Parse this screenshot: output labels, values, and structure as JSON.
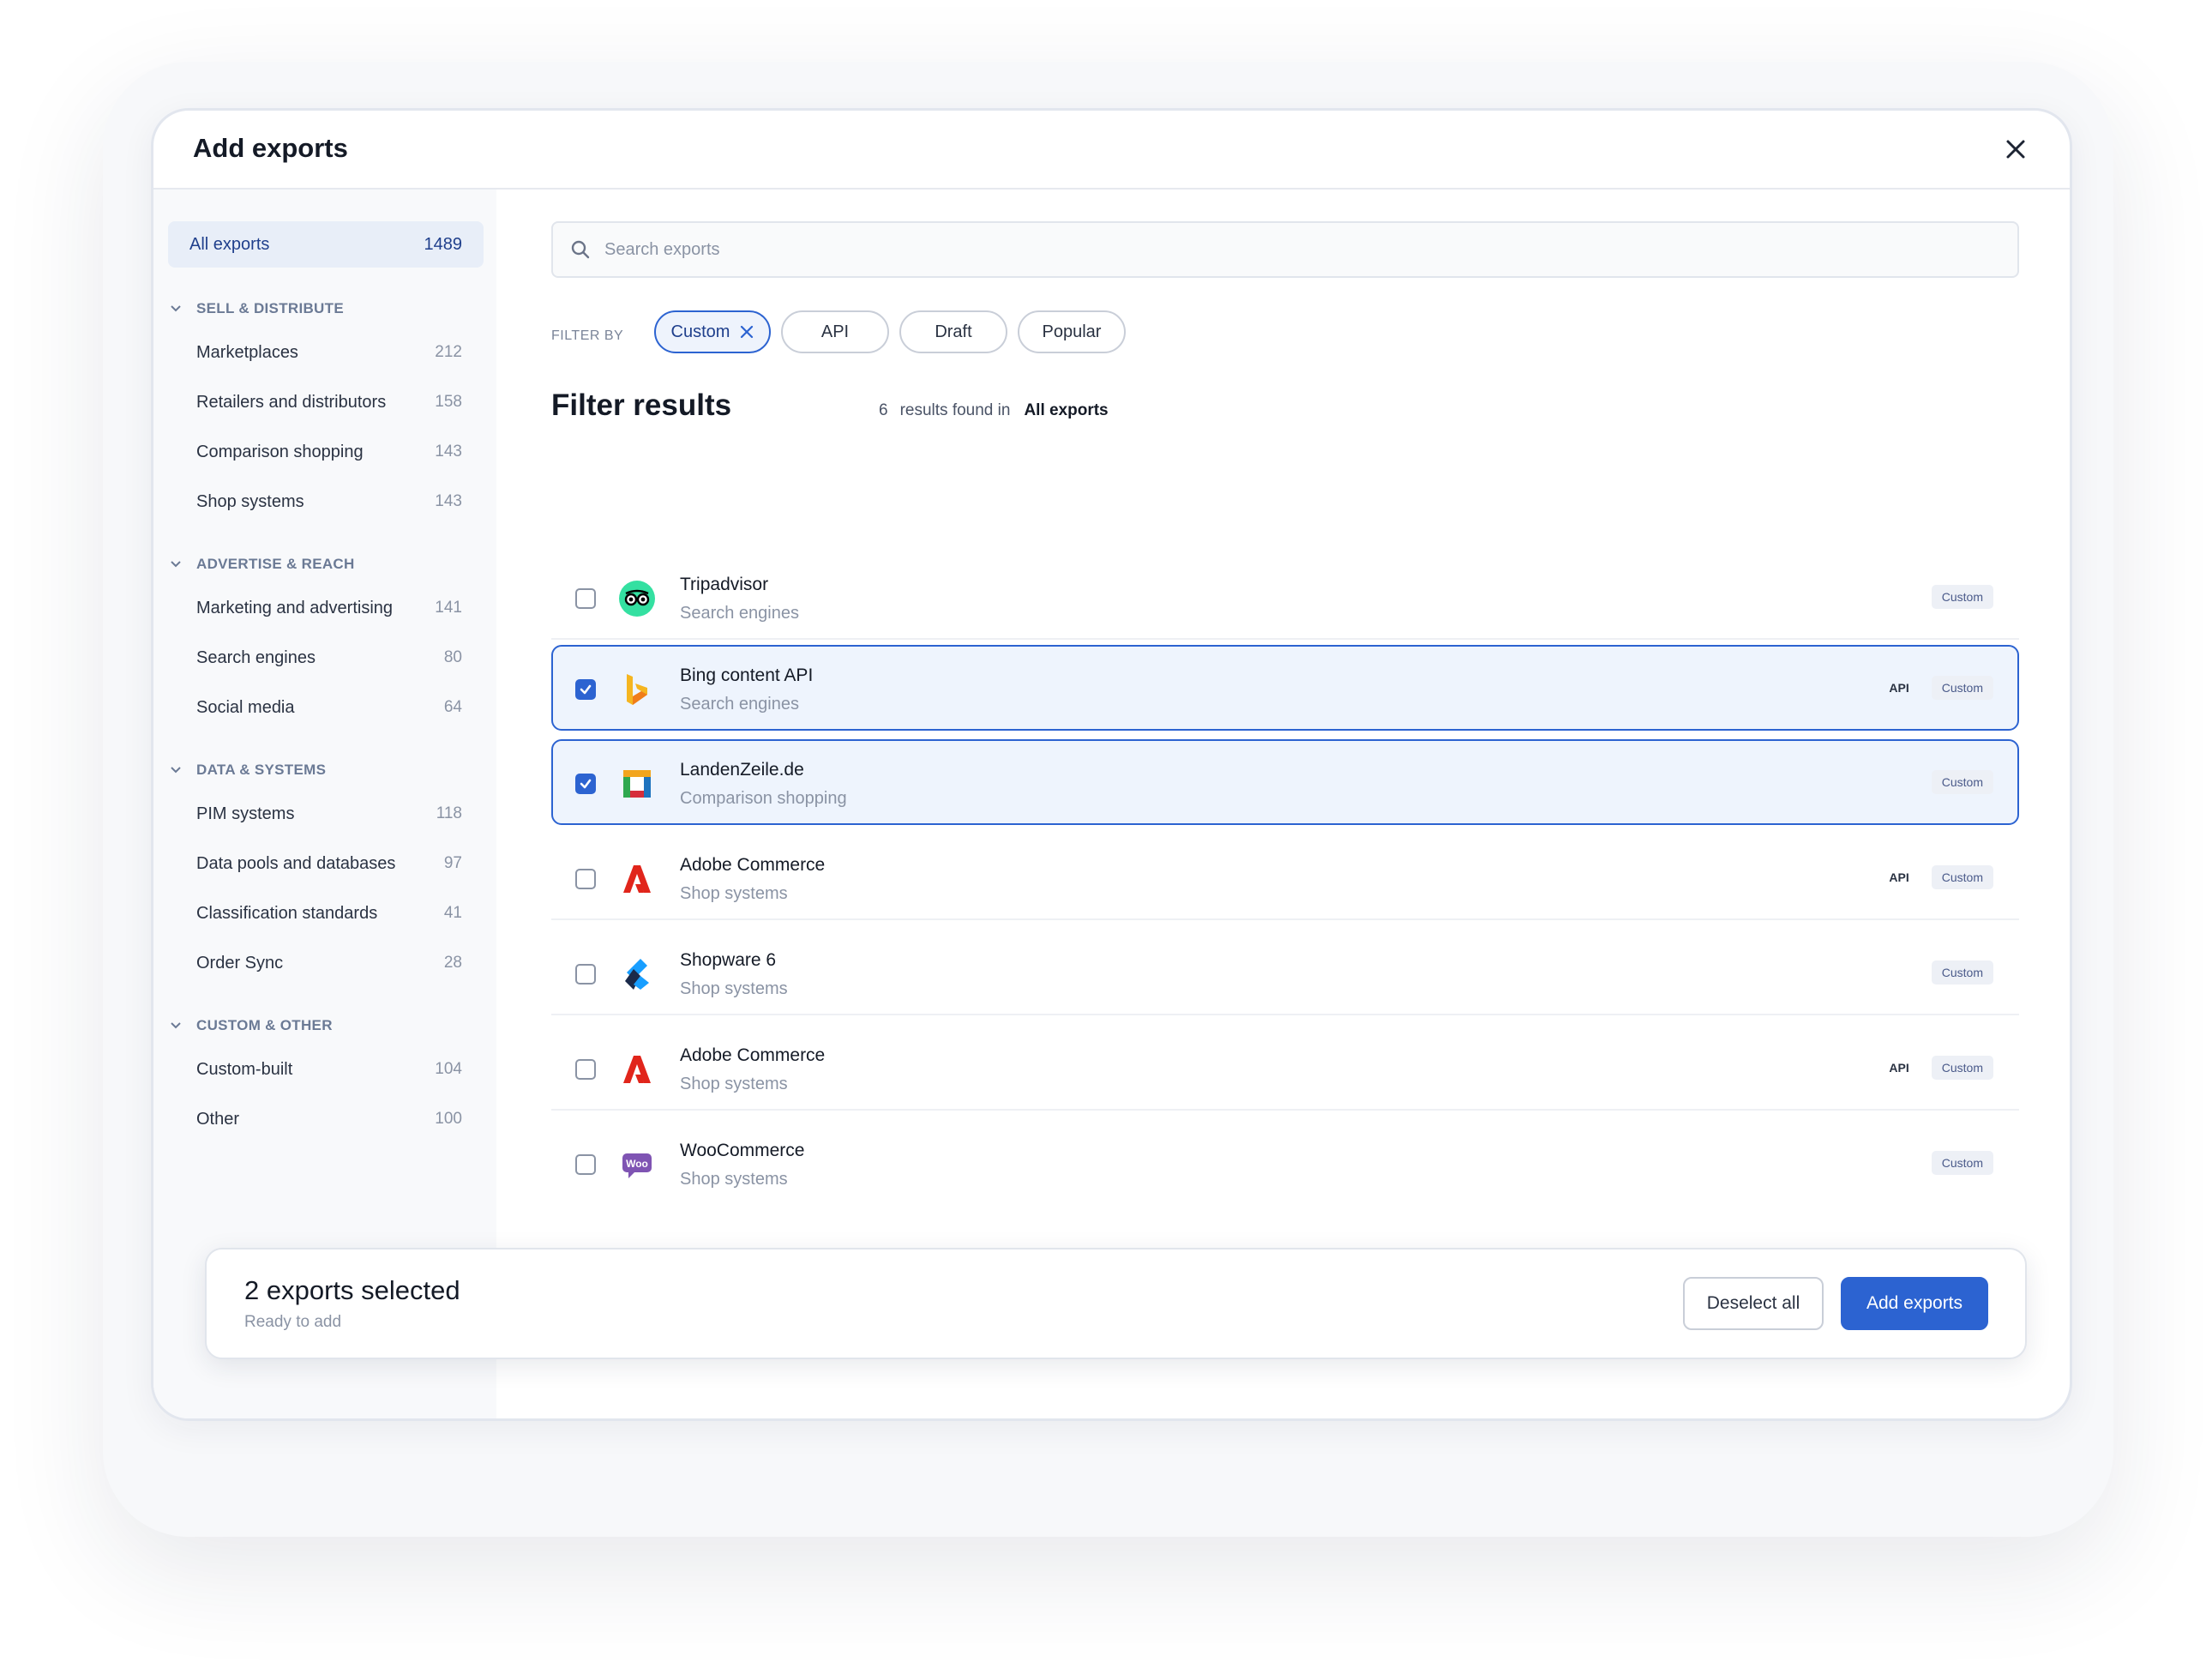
{
  "modal": {
    "title": "Add exports"
  },
  "sidebar": {
    "all": {
      "label": "All exports",
      "count": "1489"
    },
    "groups": [
      {
        "title": "SELL & DISTRIBUTE",
        "items": [
          {
            "label": "Marketplaces",
            "count": "212"
          },
          {
            "label": "Retailers and distributors",
            "count": "158"
          },
          {
            "label": "Comparison shopping",
            "count": "143"
          },
          {
            "label": "Shop systems",
            "count": "143"
          }
        ]
      },
      {
        "title": "ADVERTISE & REACH",
        "items": [
          {
            "label": "Marketing and advertising",
            "count": "141"
          },
          {
            "label": "Search engines",
            "count": "80"
          },
          {
            "label": "Social media",
            "count": "64"
          }
        ]
      },
      {
        "title": "DATA & SYSTEMS",
        "items": [
          {
            "label": "PIM systems",
            "count": "118"
          },
          {
            "label": "Data pools and databases",
            "count": "97"
          },
          {
            "label": "Classification standards",
            "count": "41"
          },
          {
            "label": "Order Sync",
            "count": "28"
          }
        ]
      },
      {
        "title": "CUSTOM & OTHER",
        "items": [
          {
            "label": "Custom-built",
            "count": "104"
          },
          {
            "label": "Other",
            "count": "100"
          }
        ]
      }
    ]
  },
  "search": {
    "placeholder": "Search exports",
    "value": ""
  },
  "filters": {
    "label": "FILTER BY",
    "chips": [
      {
        "label": "Custom",
        "active": true
      },
      {
        "label": "API",
        "active": false
      },
      {
        "label": "Draft",
        "active": false
      },
      {
        "label": "Popular",
        "active": false
      }
    ]
  },
  "results": {
    "title": "Filter results",
    "count": "6",
    "found_text": "results found in",
    "scope": "All exports",
    "items": [
      {
        "name": "Tripadvisor",
        "category": "Search engines",
        "tags": [
          "Custom"
        ],
        "selected": false,
        "logo": "tripadvisor-logo"
      },
      {
        "name": "Bing content API",
        "category": "Search engines",
        "tags": [
          "API",
          "Custom"
        ],
        "selected": true,
        "logo": "bing-logo"
      },
      {
        "name": "LandenZeile.de",
        "category": "Comparison shopping",
        "tags": [
          "Custom"
        ],
        "selected": true,
        "logo": "landenzeile-logo"
      },
      {
        "name": "Adobe Commerce",
        "category": "Shop systems",
        "tags": [
          "API",
          "Custom"
        ],
        "selected": false,
        "logo": "adobe-logo"
      },
      {
        "name": "Shopware 6",
        "category": "Shop systems",
        "tags": [
          "Custom"
        ],
        "selected": false,
        "logo": "shopware-logo"
      },
      {
        "name": "Adobe Commerce",
        "category": "Shop systems",
        "tags": [
          "API",
          "Custom"
        ],
        "selected": false,
        "logo": "adobe-logo"
      },
      {
        "name": "WooCommerce",
        "category": "Shop systems",
        "tags": [
          "Custom"
        ],
        "selected": false,
        "logo": "woocommerce-logo",
        "logo_text": "Woo"
      }
    ]
  },
  "footer": {
    "title": "2 exports selected",
    "subtitle": "Ready to add",
    "deselect_label": "Deselect all",
    "add_label": "Add exports"
  },
  "colors": {
    "accent": "#2c63d1",
    "selected_bg": "#eef4fd",
    "tag_bg": "#edf0f6"
  }
}
